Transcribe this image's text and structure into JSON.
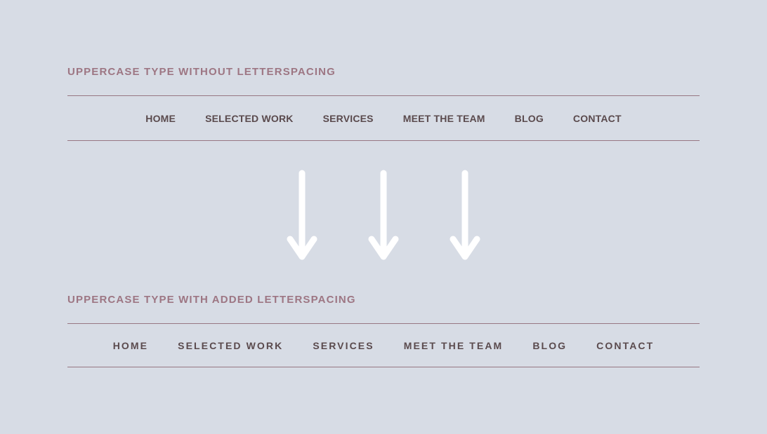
{
  "page": {
    "background_color": "#d7dce5",
    "heading_color": "#9d7683",
    "rule_color": "#8c6472",
    "nav_link_color": "#5a4a4d",
    "arrow_color": "#ffffff"
  },
  "sections": [
    {
      "heading": "UPPERCASE TYPE WITHOUT LETTERSPACING",
      "nav_items": [
        {
          "label": "HOME"
        },
        {
          "label": "SELECTED WORK"
        },
        {
          "label": "SERVICES"
        },
        {
          "label": "MEET THE TEAM"
        },
        {
          "label": "BLOG"
        },
        {
          "label": "CONTACT"
        }
      ]
    },
    {
      "heading": "UPPERCASE TYPE WITH ADDED LETTERSPACING",
      "nav_items": [
        {
          "label": "HOME"
        },
        {
          "label": "SELECTED WORK"
        },
        {
          "label": "SERVICES"
        },
        {
          "label": "MEET THE TEAM"
        },
        {
          "label": "BLOG"
        },
        {
          "label": "CONTACT"
        }
      ]
    }
  ],
  "arrows": {
    "icon": "arrow-down-icon",
    "count": 3
  }
}
